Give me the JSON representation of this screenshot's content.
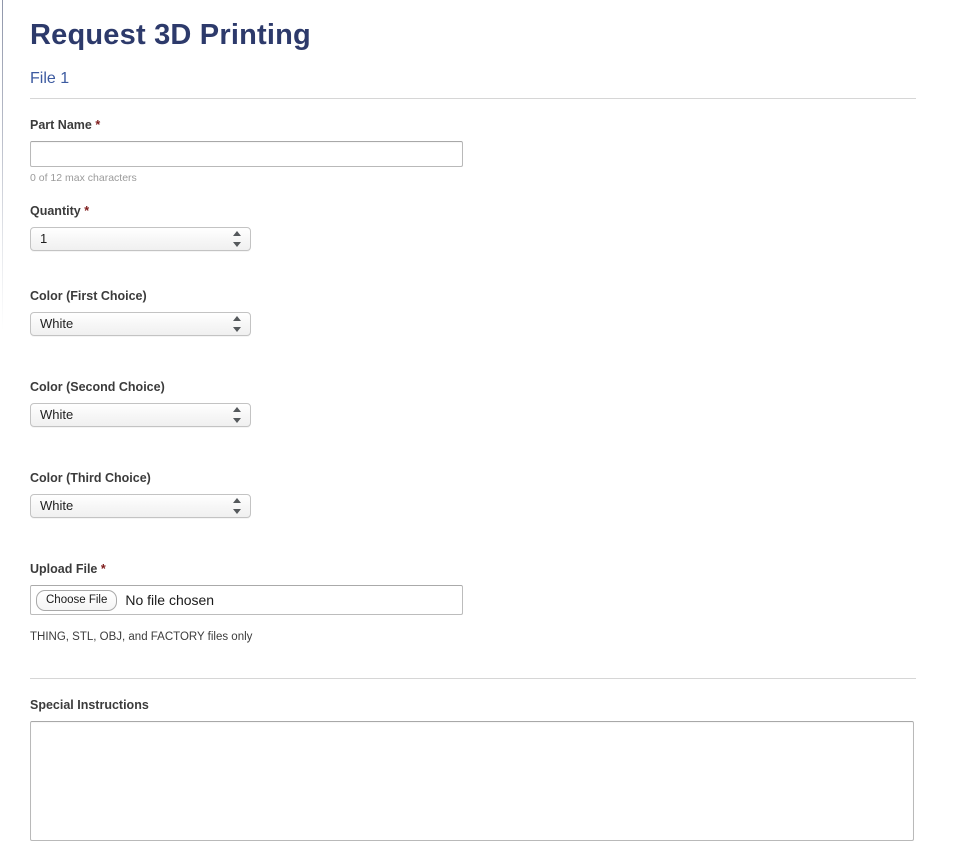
{
  "page": {
    "title": "Request 3D Printing",
    "section_heading": "File 1",
    "accent_title_color": "#2d3a6b",
    "accent_link_color": "#3c5aa0",
    "required_marker": "*",
    "required_color": "#7d1919"
  },
  "fields": {
    "part_name": {
      "label": "Part Name",
      "required": true,
      "value": "",
      "placeholder": "",
      "help": "0 of 12 max characters"
    },
    "quantity": {
      "label": "Quantity",
      "required": true,
      "selected": "1",
      "options": [
        "1"
      ]
    },
    "color_first": {
      "label": "Color (First Choice)",
      "required": false,
      "selected": "White",
      "options": [
        "White"
      ]
    },
    "color_second": {
      "label": "Color (Second Choice)",
      "required": false,
      "selected": "White",
      "options": [
        "White"
      ]
    },
    "color_third": {
      "label": "Color (Third Choice)",
      "required": false,
      "selected": "White",
      "options": [
        "White"
      ]
    },
    "upload_file": {
      "label": "Upload File",
      "required": true,
      "button_label": "Choose File",
      "status": "No file chosen",
      "help": "THING, STL, OBJ, and FACTORY files only"
    },
    "special_instructions": {
      "label": "Special Instructions",
      "required": false,
      "value": "",
      "placeholder": ""
    }
  },
  "icons": {
    "stepper": "stepper-updown-icon"
  }
}
